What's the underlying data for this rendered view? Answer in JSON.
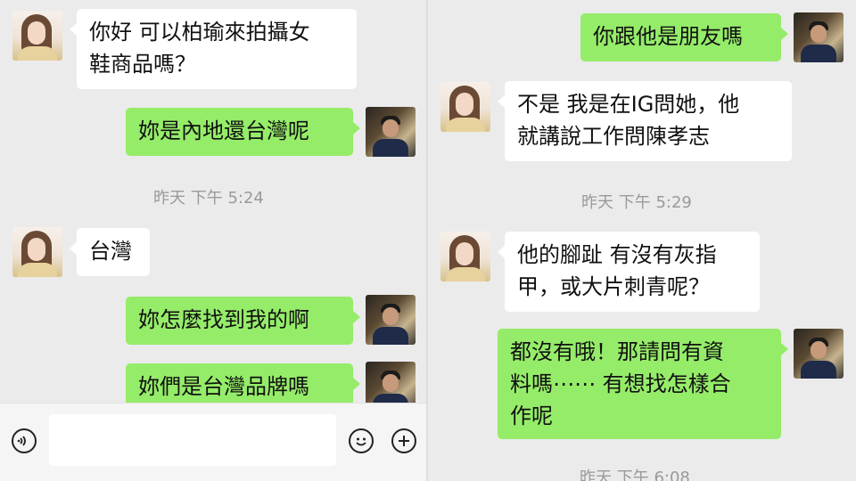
{
  "left": {
    "messages": [
      {
        "side": "in",
        "text": "你好 可以柏瑜來拍攝女\n鞋商品嗎？"
      },
      {
        "side": "out",
        "text": "妳是內地還台灣呢"
      },
      {
        "side": "in",
        "text": "台灣"
      },
      {
        "side": "out",
        "text": "妳怎麼找到我的啊"
      },
      {
        "side": "out",
        "text": "妳們是台灣品牌嗎"
      }
    ],
    "timestamp": "昨天 下午 5:24",
    "input_bar": {
      "voice_icon": "voice-icon",
      "emoji_icon": "emoji-icon",
      "plus_icon": "plus-icon"
    }
  },
  "right": {
    "messages": [
      {
        "side": "out",
        "text": "你跟他是朋友嗎"
      },
      {
        "side": "in",
        "text": "不是 我是在IG問她，他\n就講說工作問陳孝志"
      },
      {
        "side": "in",
        "text": "他的腳趾 有沒有灰指\n甲，或大片刺青呢？"
      },
      {
        "side": "out",
        "text": "都沒有哦！那請問有資\n料嗎⋯⋯ 有想找怎樣合\n作呢"
      }
    ],
    "timestamp": "昨天 下午 5:29",
    "timestamp_bottom": "昨天 下午 6:08"
  },
  "colors": {
    "outgoing_bubble": "#95ec69",
    "incoming_bubble": "#ffffff",
    "background": "#ebebeb",
    "timestamp": "#9a9a9a"
  }
}
